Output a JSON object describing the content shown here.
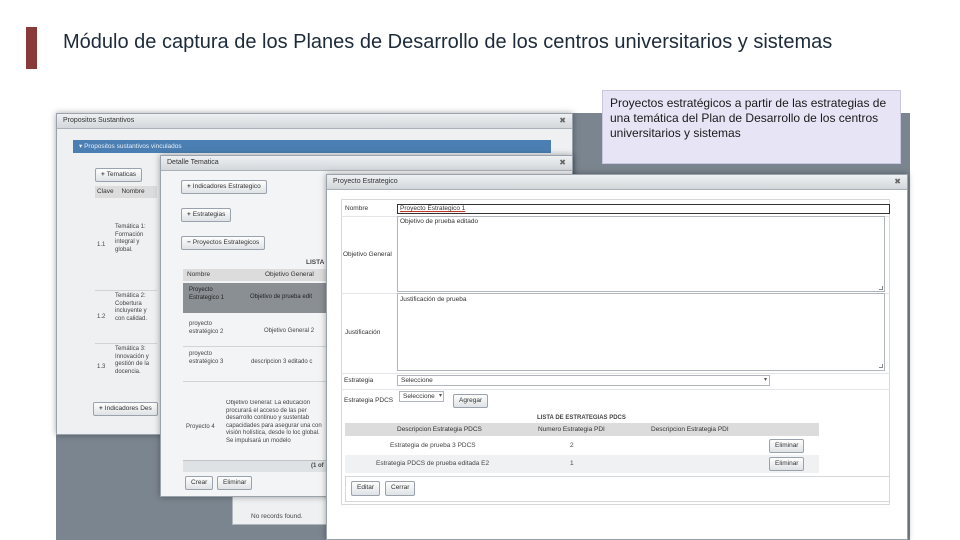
{
  "slide": {
    "title": "Módulo de captura de los Planes de Desarrollo de los centros universitarios y sistemas",
    "callout": "Proyectos estratégicos a partir de las estrategias de una temática del Plan de Desarrollo de los centros universitarios y sistemas",
    "accent_color": "#8b3a3a"
  },
  "win1": {
    "title": "Propositos Sustantivos",
    "accordion": "Propositos sustantivos vinculados",
    "tematicas_button": "Tematicas",
    "headers": [
      "Clave",
      "Nombre"
    ],
    "rows": [
      {
        "clave": "1.1",
        "nombre": "Temática 1: Formación integral y global."
      },
      {
        "clave": "1.2",
        "nombre": "Temática 2: Cobertura incluyente y con calidad."
      },
      {
        "clave": "1.3",
        "nombre": "Temática 3: Innovación y gestión de la docencia."
      }
    ],
    "indicadores_button": "Indicadores Des",
    "no_records": "No records found."
  },
  "win2": {
    "title": "Detalle Tematica",
    "indicadores_btn": "Indicadores Estrategico",
    "estrategias_btn": "Estrategias",
    "proyectos_btn": "Proyectos Estrategicos",
    "lista_label": "LISTA",
    "headers": [
      "Nombre",
      "Objetivo General"
    ],
    "rows": [
      {
        "nombre": "Proyecto Estrategico 1",
        "objetivo": "Objetivo de prueba edit"
      },
      {
        "nombre": "proyecto estratégico 2",
        "objetivo": "Objetivo General 2"
      },
      {
        "nombre": "proyecto estratégico 3",
        "objetivo": "descripcion 3 editado c"
      },
      {
        "nombre": "Proyecto 4",
        "objetivo": "Objetivo General: La educación procurará el acceso de las per desarrollo continuo y sustentab capacidades para asegurar una con visión holística, desde lo loc global. Se impulsará un modelo"
      }
    ],
    "pager": "(1 of",
    "crear": "Crear",
    "eliminar": "Eliminar"
  },
  "dialog": {
    "title": "Proyecto Estrategico",
    "labels": {
      "nombre": "Nombre",
      "objetivo": "Objetivo General",
      "justificacion": "Justificación",
      "estrategia": "Estrategia",
      "estrategia_pdcs": "Estrategia PDCS"
    },
    "values": {
      "nombre": "Proyecto Estrategico 1",
      "objetivo": "Objetivo de prueba editado",
      "justificacion": "Justificación de prueba",
      "estrategia": "Seleccione",
      "estrategia_pdcs": "Seleccione"
    },
    "agregar": "Agregar",
    "table_title": "LISTA DE ESTRATEGIAS PDCS",
    "headers": [
      "Descripcion Estrategia PDCS",
      "Numero Estrategia PDI",
      "Descripcion Estrategia PDI"
    ],
    "rows": [
      {
        "desc": "Estrategia de prueba 3 PDCS",
        "num": "2",
        "pdi": "",
        "action": "Eliminar"
      },
      {
        "desc": "Estrategia PDCS de prueba editada E2",
        "num": "1",
        "pdi": "",
        "action": "Eliminar"
      }
    ],
    "editar": "Editar",
    "cerrar": "Cerrar"
  }
}
